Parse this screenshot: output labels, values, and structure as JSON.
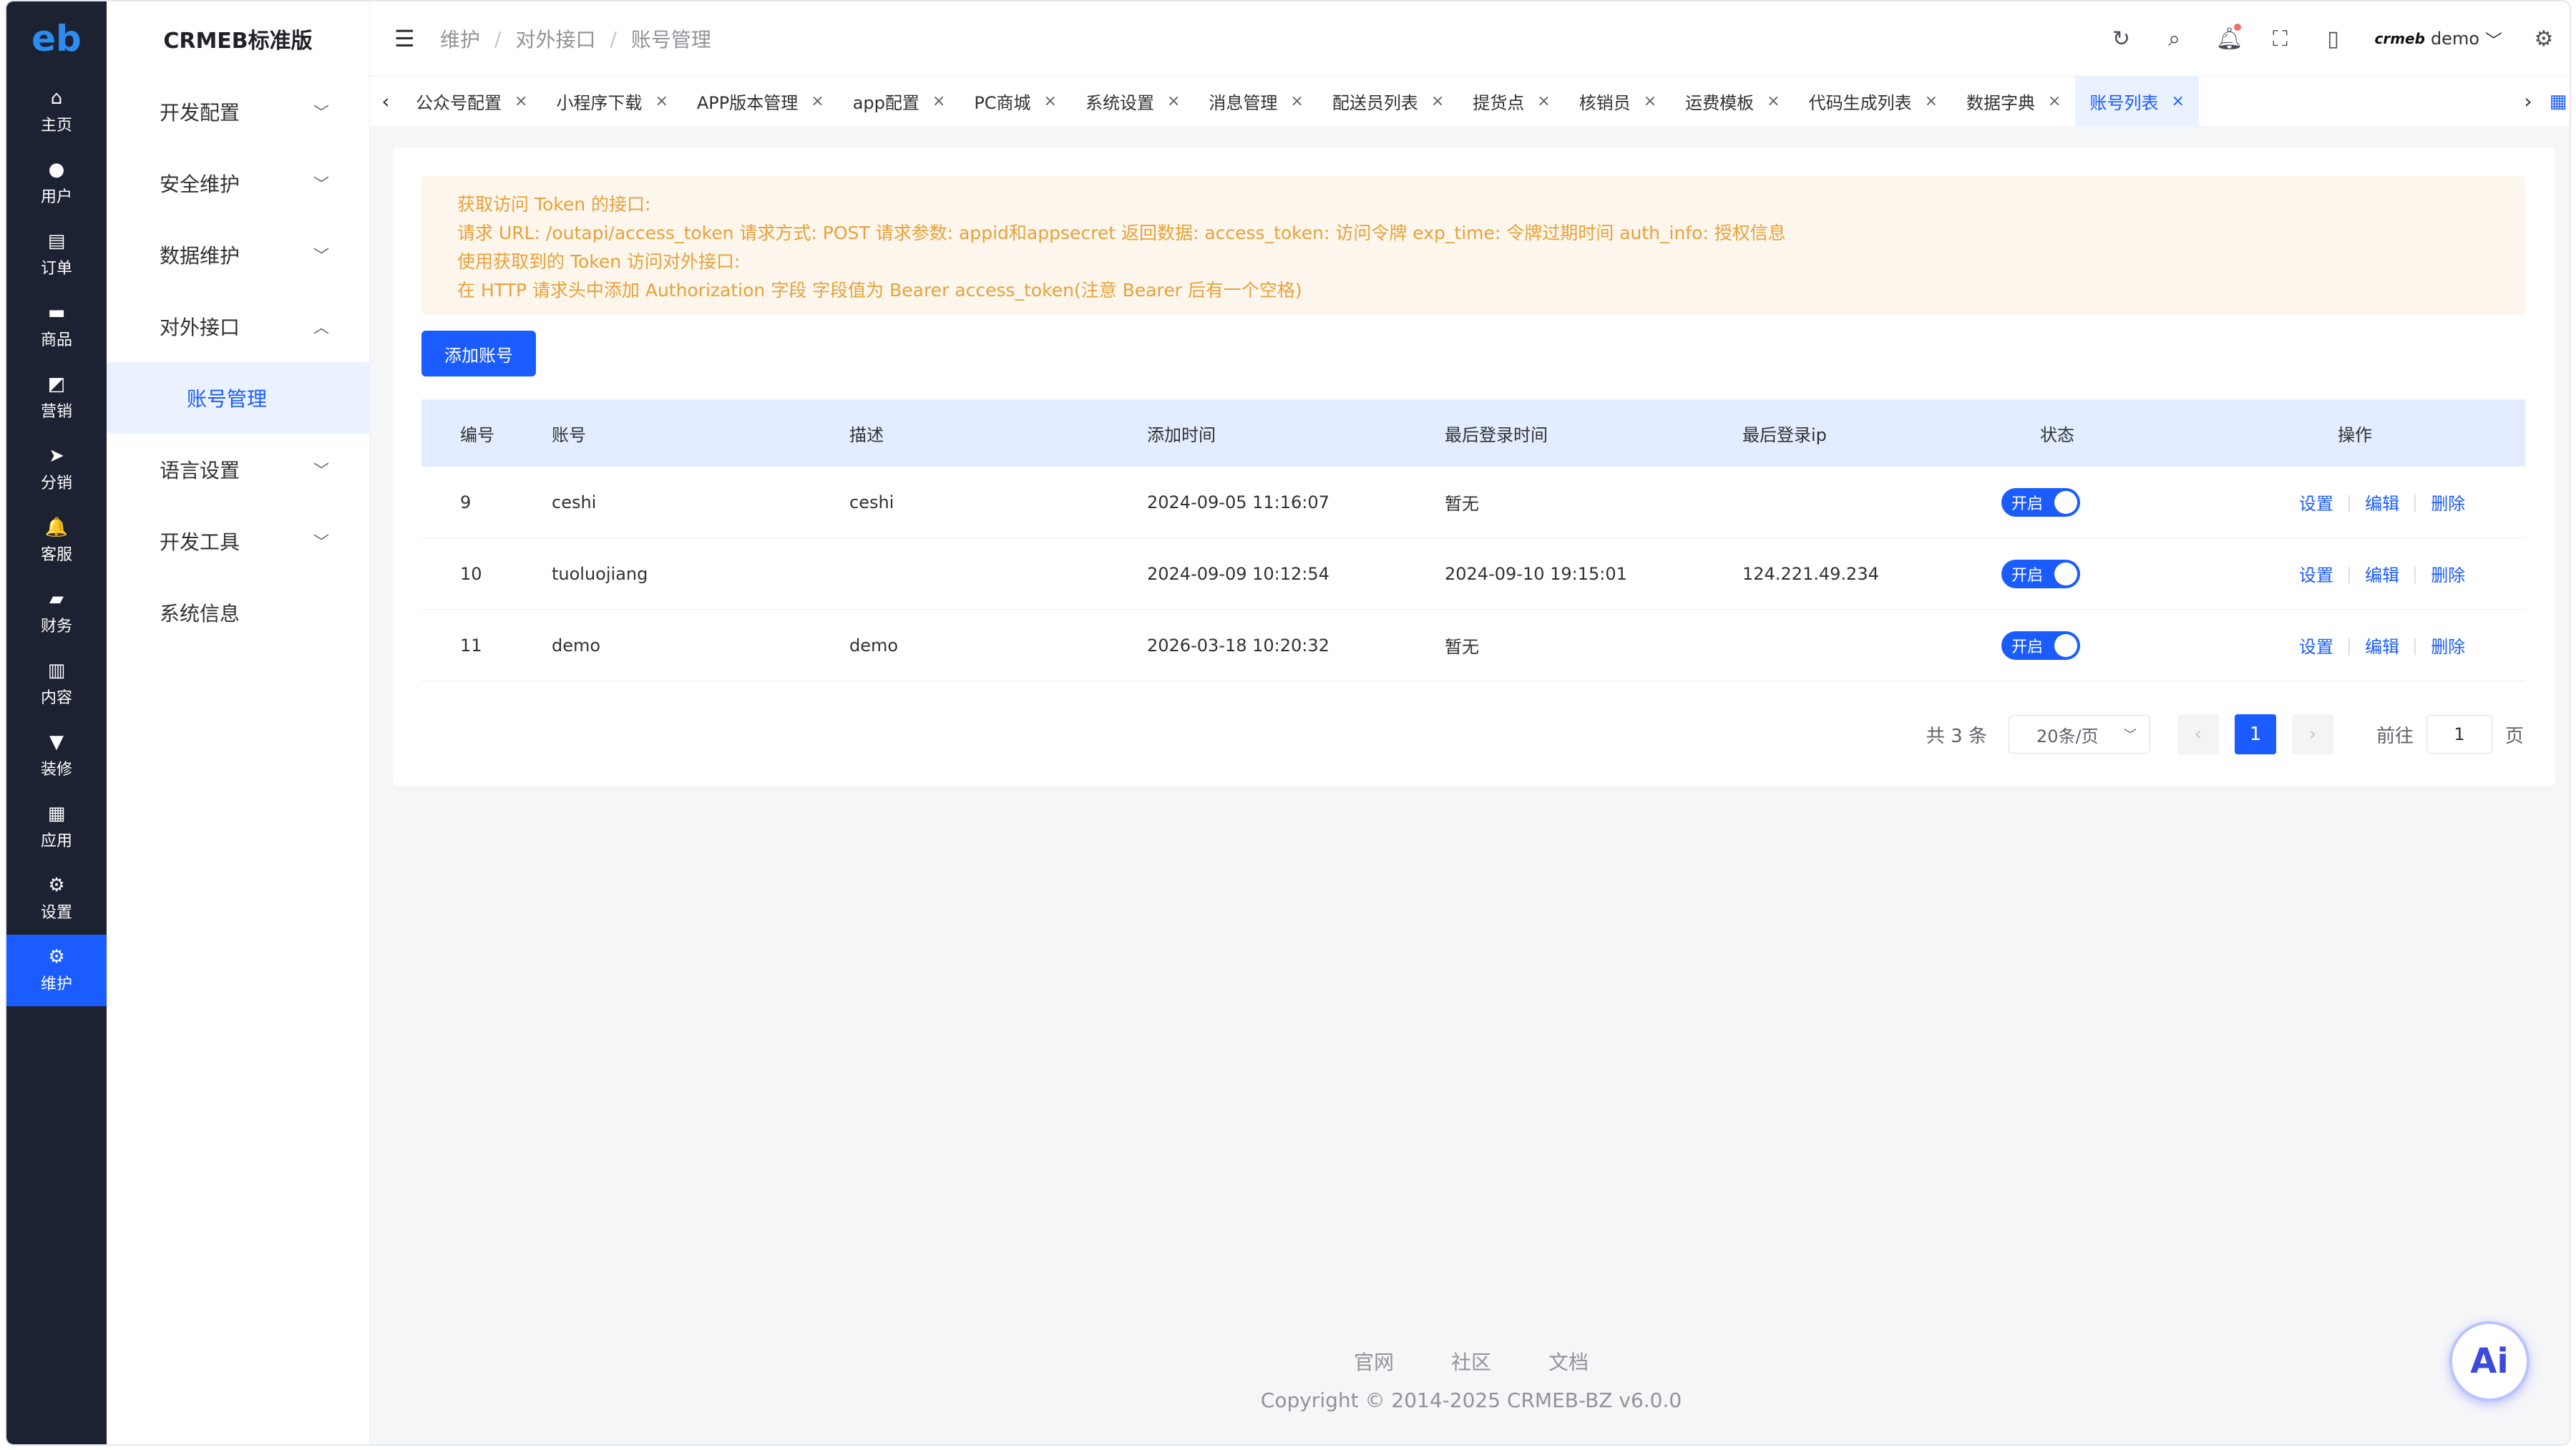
{
  "app": {
    "logo": "eb",
    "title": "CRMEB标准版"
  },
  "rail": [
    {
      "label": "主页",
      "icon": "home-icon",
      "glyph": "⌂"
    },
    {
      "label": "用户",
      "icon": "user-icon",
      "glyph": "●"
    },
    {
      "label": "订单",
      "icon": "order-icon",
      "glyph": "▤"
    },
    {
      "label": "商品",
      "icon": "goods-icon",
      "glyph": "▬"
    },
    {
      "label": "营销",
      "icon": "marketing-icon",
      "glyph": "◩"
    },
    {
      "label": "分销",
      "icon": "distribution-icon",
      "glyph": "➤"
    },
    {
      "label": "客服",
      "icon": "service-icon",
      "glyph": "🔔"
    },
    {
      "label": "财务",
      "icon": "finance-icon",
      "glyph": "▰"
    },
    {
      "label": "内容",
      "icon": "content-icon",
      "glyph": "▥"
    },
    {
      "label": "装修",
      "icon": "decorate-icon",
      "glyph": "▼"
    },
    {
      "label": "应用",
      "icon": "apps-icon",
      "glyph": "▦"
    },
    {
      "label": "设置",
      "icon": "settings-icon",
      "glyph": "⚙"
    },
    {
      "label": "维护",
      "icon": "maintenance-icon",
      "glyph": "⚙"
    }
  ],
  "subnav": {
    "groups": [
      {
        "label": "开发配置",
        "chevron": "﹀"
      },
      {
        "label": "安全维护",
        "chevron": "﹀"
      },
      {
        "label": "数据维护",
        "chevron": "﹀"
      },
      {
        "label": "对外接口",
        "chevron": "︿"
      }
    ],
    "active_item": "账号管理",
    "groups_after": [
      {
        "label": "语言设置",
        "chevron": "﹀"
      },
      {
        "label": "开发工具",
        "chevron": "﹀"
      }
    ],
    "plain_item": "系统信息"
  },
  "header": {
    "breadcrumb": [
      "维护",
      "对外接口",
      "账号管理"
    ],
    "user_brand": "crmeb",
    "user_name": "demo"
  },
  "tabs": [
    {
      "label": "公众号配置"
    },
    {
      "label": "小程序下载"
    },
    {
      "label": "APP版本管理"
    },
    {
      "label": "app配置"
    },
    {
      "label": "PC商城"
    },
    {
      "label": "系统设置"
    },
    {
      "label": "消息管理"
    },
    {
      "label": "配送员列表"
    },
    {
      "label": "提货点"
    },
    {
      "label": "核销员"
    },
    {
      "label": "运费模板"
    },
    {
      "label": "代码生成列表"
    },
    {
      "label": "数据字典"
    },
    {
      "label": "账号列表"
    }
  ],
  "notice": [
    "获取访问 Token 的接口:",
    "请求 URL: /outapi/access_token 请求方式: POST 请求参数: appid和appsecret 返回数据: access_token: 访问令牌 exp_time: 令牌过期时间 auth_info: 授权信息",
    "使用获取到的 Token 访问对外接口:",
    "在 HTTP 请求头中添加 Authorization 字段 字段值为 Bearer access_token(注意 Bearer 后有一个空格)"
  ],
  "add_button": "添加账号",
  "table": {
    "headers": [
      "编号",
      "账号",
      "描述",
      "添加时间",
      "最后登录时间",
      "最后登录ip",
      "状态",
      "操作"
    ],
    "rows": [
      {
        "id": "9",
        "account": "ceshi",
        "desc": "ceshi",
        "added": "2024-09-05 11:16:07",
        "last_login": "暂无",
        "ip": "",
        "status": "开启"
      },
      {
        "id": "10",
        "account": "tuoluojiang",
        "desc": "",
        "added": "2024-09-09 10:12:54",
        "last_login": "2024-09-10 19:15:01",
        "ip": "124.221.49.234",
        "status": "开启"
      },
      {
        "id": "11",
        "account": "demo",
        "desc": "demo",
        "added": "2026-03-18 10:20:32",
        "last_login": "暂无",
        "ip": "",
        "status": "开启"
      }
    ],
    "ops": [
      "设置",
      "编辑",
      "删除"
    ]
  },
  "pager": {
    "total": "共 3 条",
    "size": "20条/页",
    "current": "1",
    "goto": "前往",
    "goto_value": "1",
    "page_unit": "页"
  },
  "footer": {
    "links": [
      "官网",
      "社区",
      "文档"
    ],
    "copyright": "Copyright © 2014-2025 CRMEB-BZ v6.0.0"
  },
  "ai_button": "Ai",
  "colors": {
    "primary": "#1a5cff",
    "rail": "#1c2232",
    "notice_text": "#e6a23c",
    "notice_bg": "#fdf6ec"
  }
}
